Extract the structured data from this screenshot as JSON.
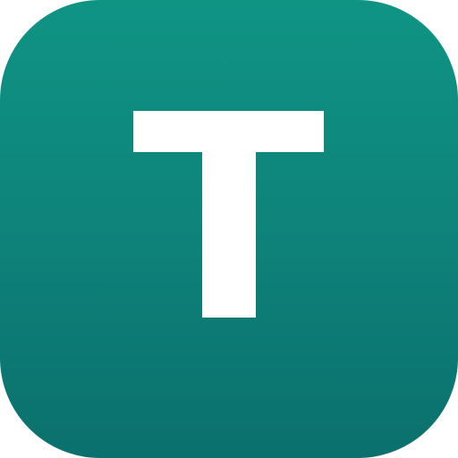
{
  "icon": {
    "name": "app-icon",
    "letter": "T",
    "colors": {
      "background_top": "#0f9484",
      "background_bottom": "#0b706d",
      "glyph": "#ffffff"
    }
  }
}
